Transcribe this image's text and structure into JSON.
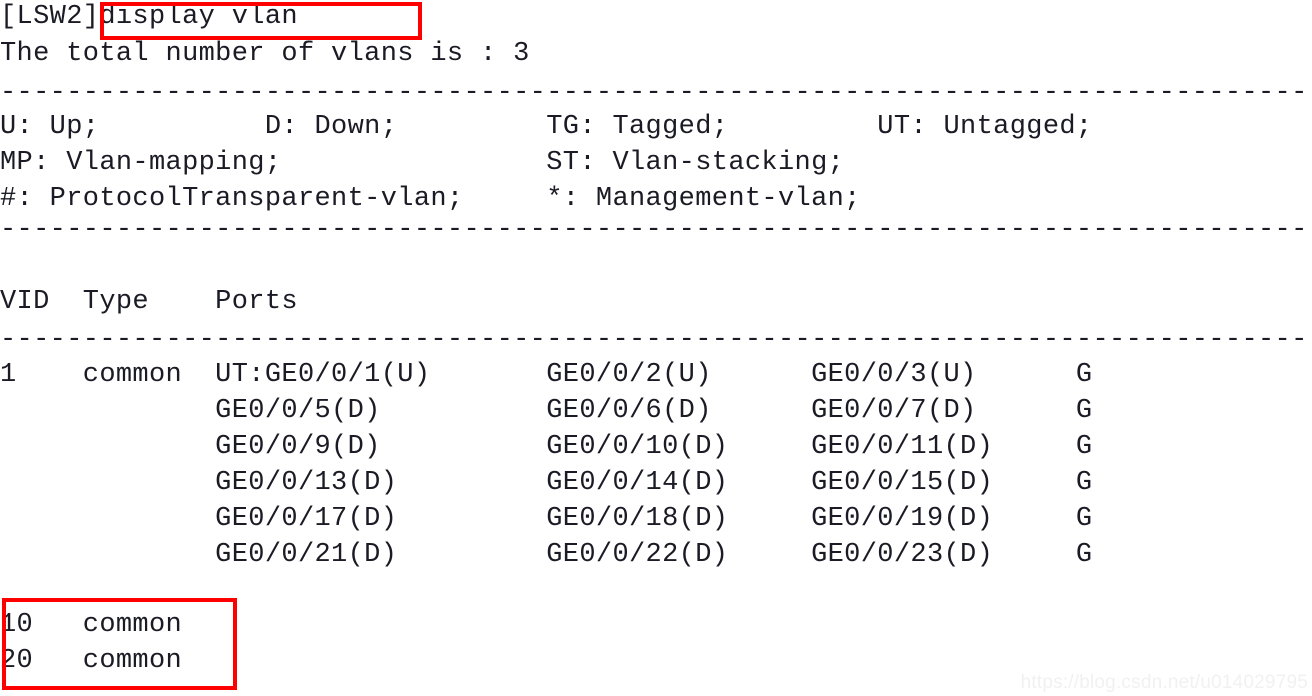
{
  "terminal": {
    "prompt_line": {
      "prompt": "[LSW2]",
      "command": "display vlan",
      "full": "[LSW2]display vlan"
    },
    "summary_line": "The total number of vlans is : 3",
    "separator": "----------------------------------------------------------------------------------",
    "legend": {
      "row1": "U: Up;          D: Down;         TG: Tagged;         UT: Untagged;",
      "row2": "MP: Vlan-mapping;                ST: Vlan-stacking;",
      "row3": "#: ProtocolTransparent-vlan;     *: Management-vlan;"
    },
    "table": {
      "header": "VID  Type    Ports",
      "rows": [
        "1    common  UT:GE0/0/1(U)       GE0/0/2(U)      GE0/0/3(U)      G",
        "             GE0/0/5(D)          GE0/0/6(D)      GE0/0/7(D)      G",
        "             GE0/0/9(D)          GE0/0/10(D)     GE0/0/11(D)     G",
        "             GE0/0/13(D)         GE0/0/14(D)     GE0/0/15(D)     G",
        "             GE0/0/17(D)         GE0/0/18(D)     GE0/0/19(D)     G",
        "             GE0/0/21(D)         GE0/0/22(D)     GE0/0/23(D)     G"
      ],
      "vlan10": "10   common",
      "vlan20": "20   common"
    }
  },
  "annotations": {
    "command_highlight_label": "display vlan command highlight",
    "vlan_highlight_label": "vlan 10 and 20 highlight",
    "color": "#ff0000"
  },
  "watermark": {
    "text": "https://blog.csdn.net/u014029795"
  }
}
